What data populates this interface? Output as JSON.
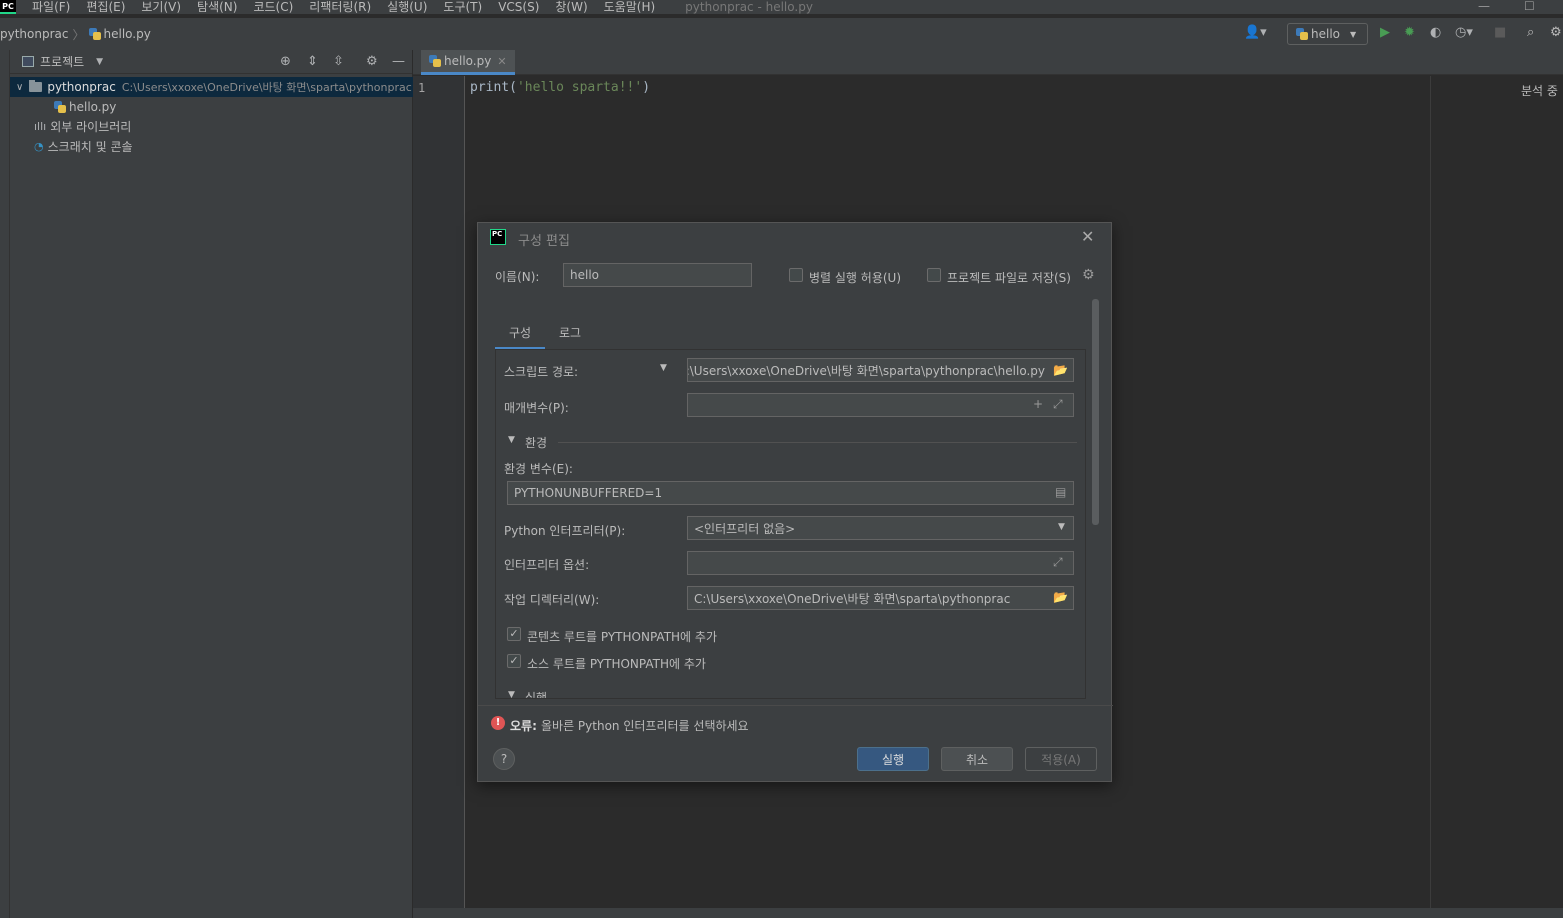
{
  "menubar": {
    "items": [
      "파일(F)",
      "편집(E)",
      "보기(V)",
      "탐색(N)",
      "코드(C)",
      "리팩터링(R)",
      "실행(U)",
      "도구(T)",
      "VCS(S)",
      "창(W)",
      "도움말(H)"
    ],
    "window_title": "pythonprac - hello.py"
  },
  "navbar": {
    "project": "pythonprac",
    "file": "hello.py",
    "run_config": "hello"
  },
  "project_panel": {
    "header": "프로젝트",
    "root_name": "pythonprac",
    "root_path": "C:\\Users\\xxoxe\\OneDrive\\바탕 화면\\sparta\\pythonprac",
    "file": "hello.py",
    "external_libs": "외부 라이브러리",
    "scratches": "스크래치 및 콘솔"
  },
  "editor": {
    "tab": "hello.py",
    "line_number": "1",
    "code_fn": "print(",
    "code_str": "'hello sparta!!'",
    "code_end": ")",
    "analysis": "분석 중"
  },
  "dialog": {
    "title": "구성 편집",
    "name_label": "이름(N):",
    "name_value": "hello",
    "parallel_label": "병렬 실행 허용(U)",
    "store_label": "프로젝트 파일로 저장(S)",
    "tabs": [
      "구성",
      "로그"
    ],
    "script_label": "스크립트 경로:",
    "script_value": "C:\\Users\\xxoxe\\OneDrive\\바탕 화면\\sparta\\pythonprac\\hello.py",
    "params_label": "매개변수(P):",
    "env_section": "환경",
    "env_vars_label": "환경 변수(E):",
    "env_vars_value": "PYTHONUNBUFFERED=1",
    "interpreter_label": "Python 인터프리터(P):",
    "interpreter_value": "<인터프리터 없음>",
    "interp_opts_label": "인터프리터 옵션:",
    "workdir_label": "작업 디렉터리(W):",
    "workdir_value": "C:\\Users\\xxoxe\\OneDrive\\바탕 화면\\sparta\\pythonprac",
    "content_roots_label": "콘텐츠 루트를 PYTHONPATH에 추가",
    "source_roots_label": "소스 루트를 PYTHONPATH에 추가",
    "exec_section": "실행",
    "error_prefix": "오류:",
    "error_text": "올바른 Python 인터프리터를 선택하세요",
    "run_button": "실행",
    "cancel_button": "취소",
    "apply_button": "적용(A)"
  },
  "colors": {
    "accent": "#4a88c7",
    "primary_button": "#365880",
    "error": "#e05555",
    "string": "#6a8759"
  }
}
